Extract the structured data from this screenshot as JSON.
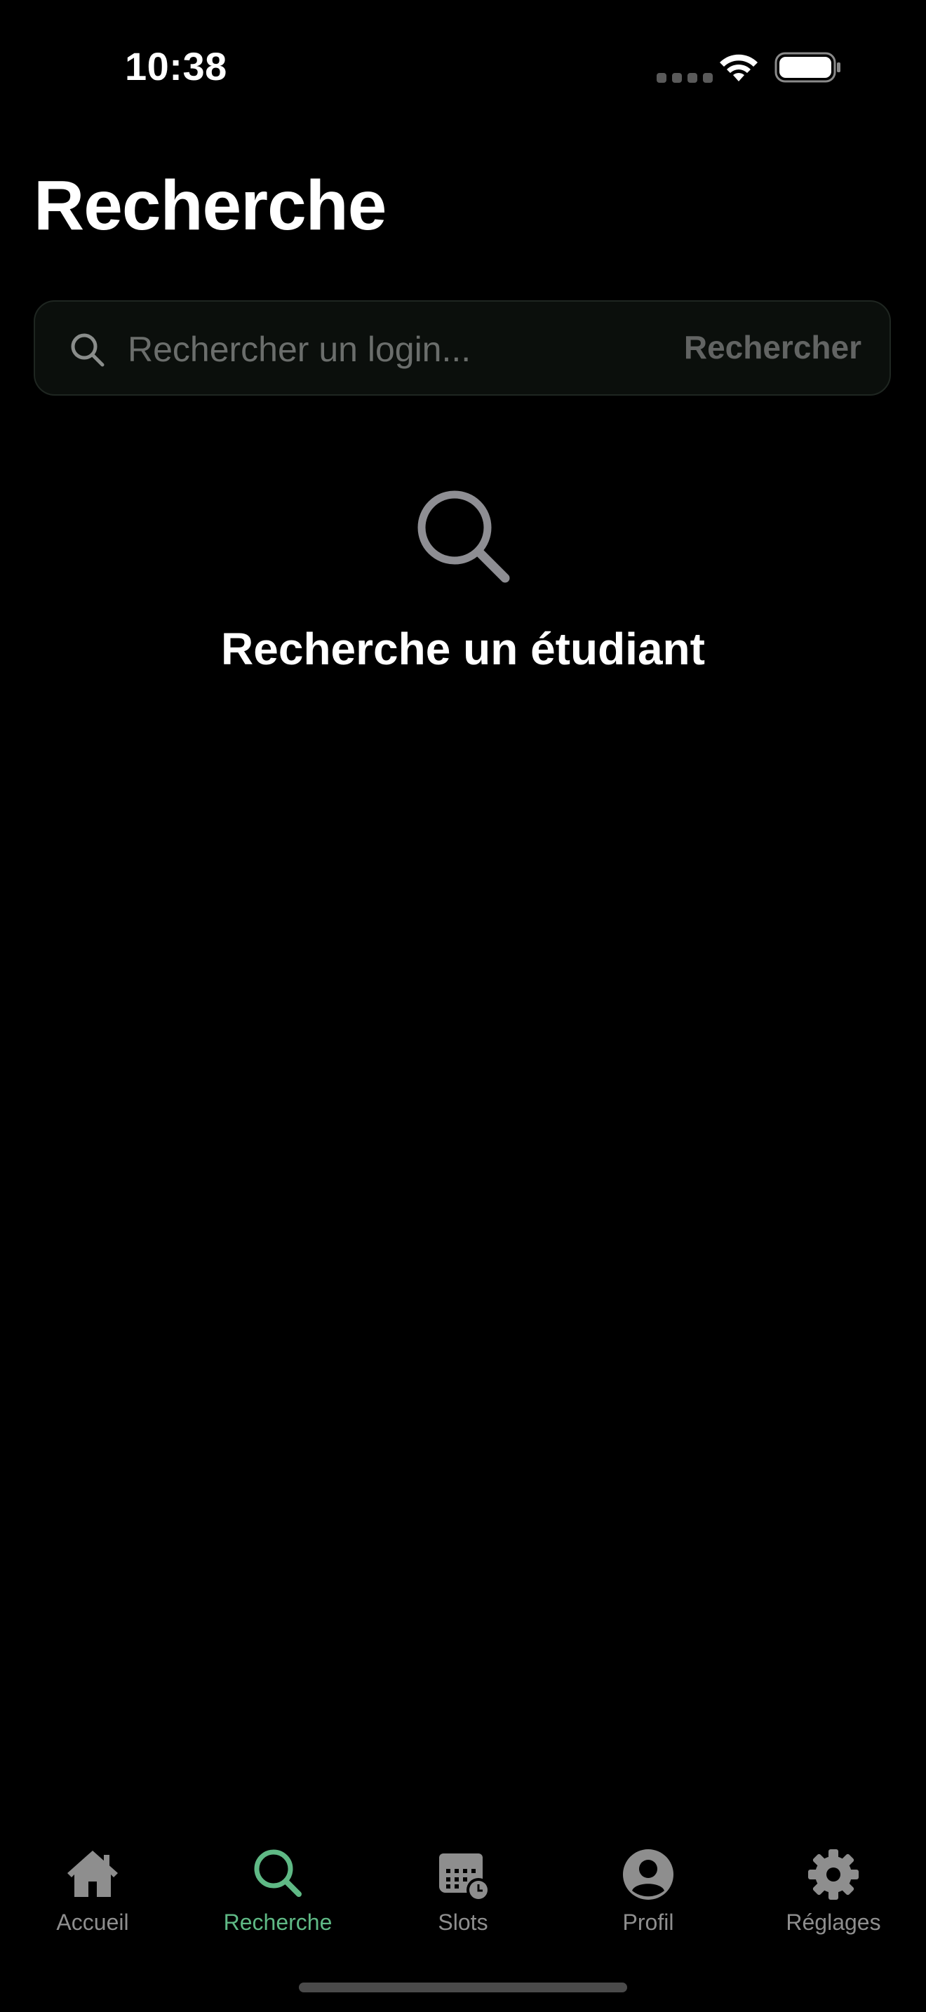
{
  "status_bar": {
    "time": "10:38"
  },
  "page": {
    "title": "Recherche"
  },
  "search": {
    "placeholder": "Rechercher un login...",
    "value": "",
    "submit_label": "Rechercher",
    "icon": "search-icon"
  },
  "empty_state": {
    "icon": "search-icon",
    "message": "Recherche un étudiant"
  },
  "tab_bar": {
    "active_color": "#5fb985",
    "inactive_color": "#8e8e8e",
    "tabs": [
      {
        "label": "Accueil",
        "icon": "house-icon",
        "active": false
      },
      {
        "label": "Recherche",
        "icon": "search-icon",
        "active": true
      },
      {
        "label": "Slots",
        "icon": "calendar-clock-icon",
        "active": false
      },
      {
        "label": "Profil",
        "icon": "person-circle-icon",
        "active": false
      },
      {
        "label": "Réglages",
        "icon": "gear-icon",
        "active": false
      }
    ]
  }
}
